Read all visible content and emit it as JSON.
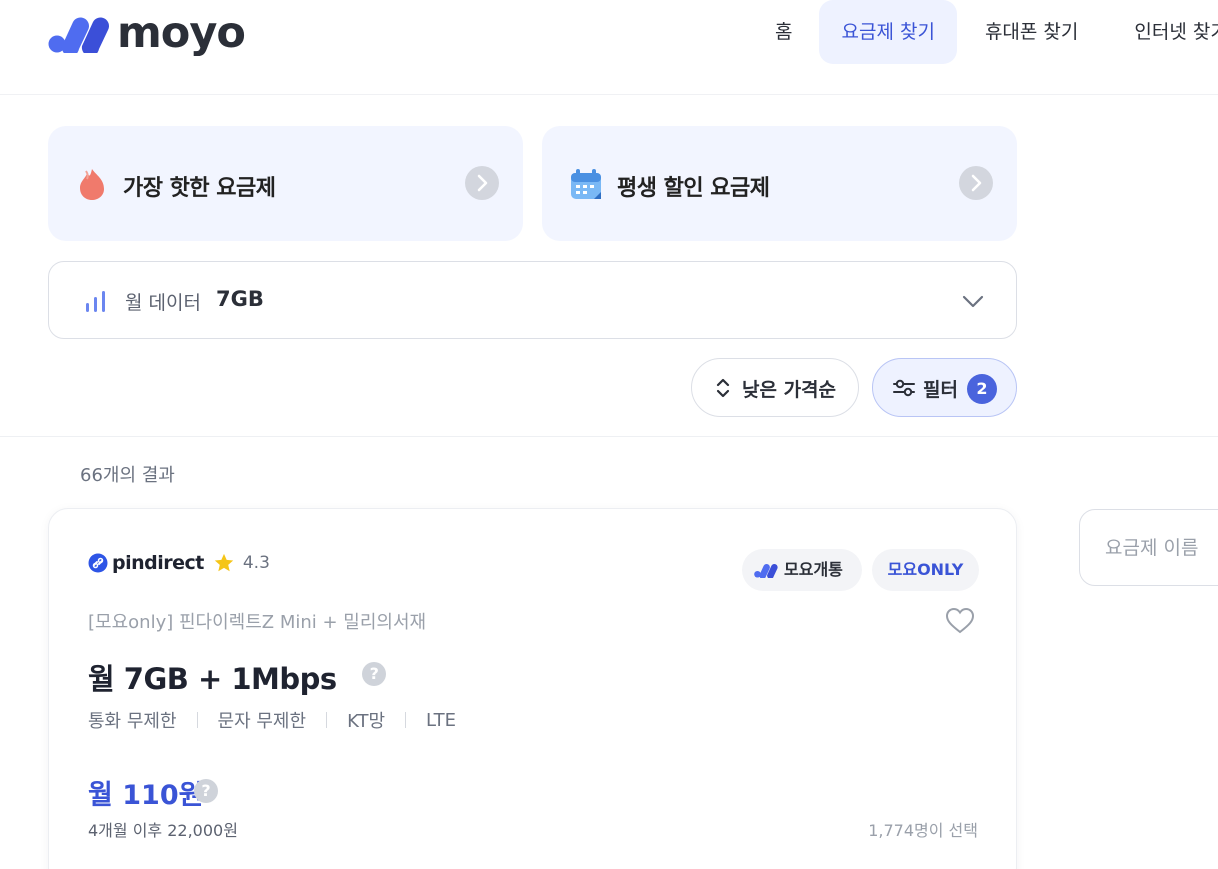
{
  "header": {
    "logo_text": "moyo",
    "nav": [
      {
        "label": "홈"
      },
      {
        "label": "요금제 찾기"
      },
      {
        "label": "휴대폰 찾기"
      },
      {
        "label": "인터넷 찾기"
      }
    ]
  },
  "promos": [
    {
      "label": "가장 핫한 요금제",
      "icon": "fire-icon"
    },
    {
      "label": "평생 할인 요금제",
      "icon": "calendar-icon"
    }
  ],
  "data_filter": {
    "label": "월 데이터",
    "value": "7GB"
  },
  "sort": {
    "label": "낮은 가격순"
  },
  "filter": {
    "label": "필터",
    "count": "2"
  },
  "results": {
    "count_text": "66개의 결과"
  },
  "plan": {
    "brand": "pindirect",
    "rating": "4.3",
    "tags": [
      "모요개통",
      "모요ONLY"
    ],
    "subtitle": "[모요only] 핀다이렉트Z Mini + 밀리의서재",
    "title": "월 7GB + 1Mbps",
    "features": [
      "통화 무제한",
      "문자 무제한",
      "KT망",
      "LTE"
    ],
    "price": "월 110원",
    "after_price": "4개월 이후 22,000원",
    "chosen": "1,774명이 선택"
  },
  "search": {
    "placeholder": "요금제 이름"
  },
  "colors": {
    "brand_blue": "#3a54d6",
    "promo_bg": "#f2f5ff",
    "badge_bg": "#4a64dd"
  }
}
